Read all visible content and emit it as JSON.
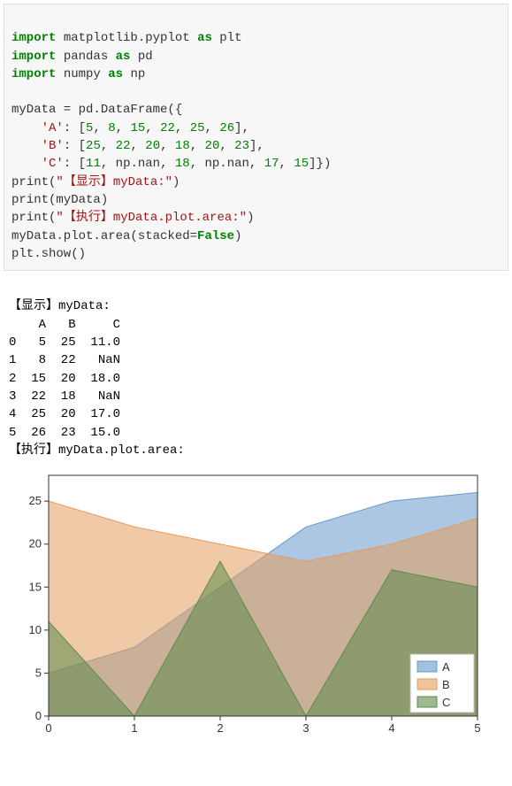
{
  "code": {
    "l1_kw1": "import",
    "l1_mod": " matplotlib.pyplot ",
    "l1_kw2": "as",
    "l1_alias": " plt",
    "l2_kw1": "import",
    "l2_mod": " pandas ",
    "l2_kw2": "as",
    "l2_alias": " pd",
    "l3_kw1": "import",
    "l3_mod": " numpy ",
    "l3_kw2": "as",
    "l3_alias": " np",
    "l5": "myData = pd.DataFrame({",
    "l6_key": "'A'",
    "l6_sep": ": [",
    "l6_v1": "5",
    "l6_c1": ", ",
    "l6_v2": "8",
    "l6_c2": ", ",
    "l6_v3": "15",
    "l6_c3": ", ",
    "l6_v4": "22",
    "l6_c4": ", ",
    "l6_v5": "25",
    "l6_c5": ", ",
    "l6_v6": "26",
    "l6_end": "],",
    "l7_key": "'B'",
    "l7_sep": ": [",
    "l7_v1": "25",
    "l7_c1": ", ",
    "l7_v2": "22",
    "l7_c2": ", ",
    "l7_v3": "20",
    "l7_c3": ", ",
    "l7_v4": "18",
    "l7_c4": ", ",
    "l7_v5": "20",
    "l7_c5": ", ",
    "l7_v6": "23",
    "l7_end": "],",
    "l8_key": "'C'",
    "l8_sep": ": [",
    "l8_v1": "11",
    "l8_c1": ", np.nan, ",
    "l8_v2": "18",
    "l8_c2": ", np.nan, ",
    "l8_v3": "17",
    "l8_c3": ", ",
    "l8_v4": "15",
    "l8_end": "]})",
    "l9_a": "print(",
    "l9_str": "\"【显示】myData:\"",
    "l9_b": ")",
    "l10": "print(myData)",
    "l11_a": "print(",
    "l11_str": "\"【执行】myData.plot.area:\"",
    "l11_b": ")",
    "l12_a": "myData.plot.area(stacked=",
    "l12_bool": "False",
    "l12_b": ")",
    "l13": "plt.show()"
  },
  "output": {
    "t1": "【显示】myData:",
    "hdr": "    A   B     C",
    "r0": "0   5  25  11.0",
    "r1": "1   8  22   NaN",
    "r2": "2  15  20  18.0",
    "r3": "3  22  18   NaN",
    "r4": "4  25  20  17.0",
    "r5": "5  26  23  15.0",
    "t2": "【执行】myData.plot.area:"
  },
  "chart_data": {
    "type": "area",
    "x": [
      0,
      1,
      2,
      3,
      4,
      5
    ],
    "series": [
      {
        "name": "A",
        "values": [
          5,
          8,
          15,
          22,
          25,
          26
        ],
        "color": "#6699cc"
      },
      {
        "name": "B",
        "values": [
          25,
          22,
          20,
          18,
          20,
          23
        ],
        "color": "#e39c5c"
      },
      {
        "name": "C",
        "values": [
          11,
          0,
          18,
          0,
          17,
          15
        ],
        "color": "#5d8a4a"
      }
    ],
    "xticks": [
      "0",
      "1",
      "2",
      "3",
      "4",
      "5"
    ],
    "yticks": [
      "0",
      "5",
      "10",
      "15",
      "20",
      "25"
    ],
    "ylim": [
      0,
      28
    ],
    "xlim": [
      0,
      5
    ],
    "legend": [
      "A",
      "B",
      "C"
    ],
    "colors": {
      "A": "#6699cc",
      "B": "#e39c5c",
      "C": "#5d8a4a"
    }
  }
}
